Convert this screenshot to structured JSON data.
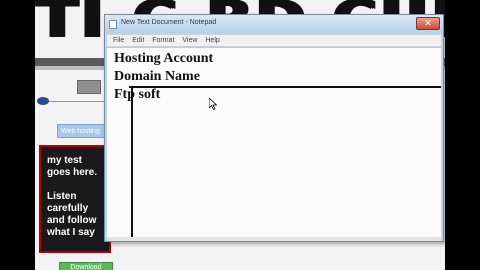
{
  "site": {
    "logo_text": "TI.C.BD CIIIIID",
    "web_link": "Web hosting",
    "promo_lines": [
      "my test goes here.",
      "Listen carefully and follow what I say"
    ],
    "download_label": "Download"
  },
  "notepad": {
    "title": "New Text Document - Notepad",
    "menu": [
      "File",
      "Edit",
      "Format",
      "View",
      "Help"
    ],
    "lines": [
      "Hosting Account",
      "Domain Name",
      "Ftp soft"
    ]
  },
  "colors": {
    "title_bar": "#b7cfe8",
    "close_button": "#c9493a",
    "promo_bg": "#1a1a1a",
    "promo_border": "#b30000"
  },
  "icons": {
    "close": "close-icon",
    "app": "notepad-icon",
    "cursor": "mouse-pointer-icon"
  }
}
